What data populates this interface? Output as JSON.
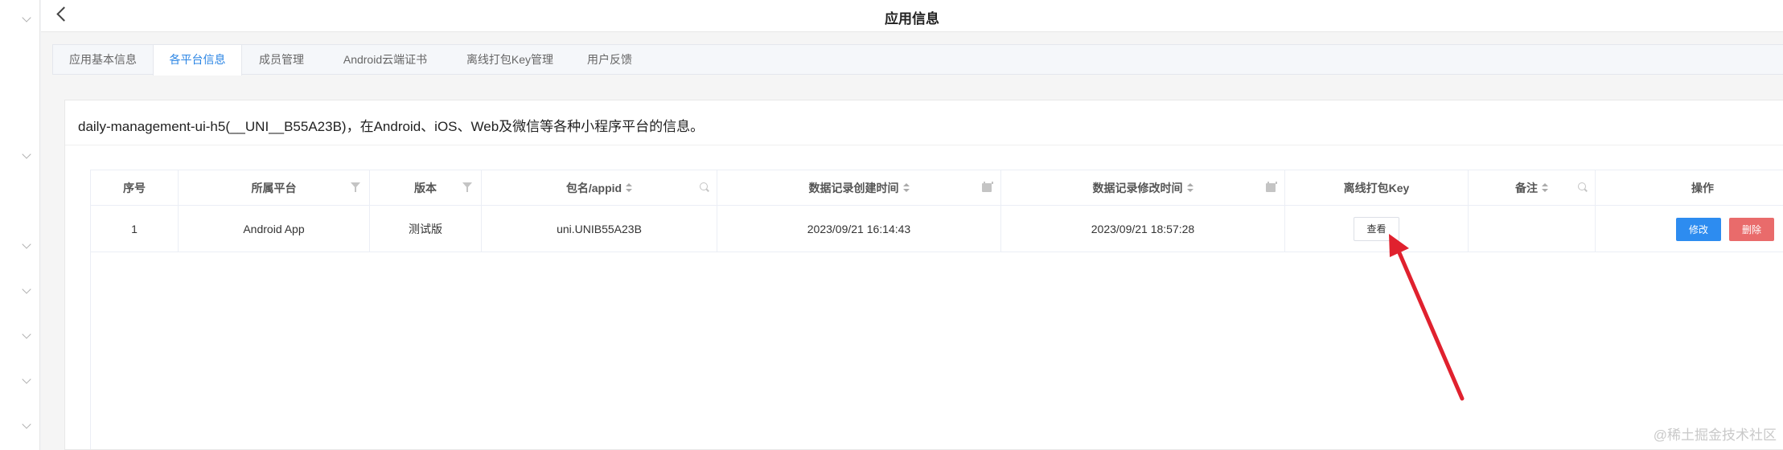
{
  "header": {
    "title": "应用信息"
  },
  "tabs": [
    {
      "label": "应用基本信息"
    },
    {
      "label": "各平台信息"
    },
    {
      "label": "成员管理"
    },
    {
      "label": "Android云端证书"
    },
    {
      "label": "离线打包Key管理"
    },
    {
      "label": "用户反馈"
    }
  ],
  "description": "daily-management-ui-h5(__UNI__B55A23B)，在Android、iOS、Web及微信等各种小程序平台的信息。",
  "table": {
    "headers": [
      "序号",
      "所属平台",
      "版本",
      "包名/appid",
      "数据记录创建时间",
      "数据记录修改时间",
      "离线打包Key",
      "备注",
      "操作"
    ],
    "rows": [
      {
        "index": "1",
        "platform": "Android App",
        "version": "测试版",
        "appid": "uni.UNIB55A23B",
        "created": "2023/09/21 16:14:43",
        "modified": "2023/09/21 18:57:28",
        "key_button": "查看",
        "note": "",
        "edit_button": "修改",
        "delete_button": "删除"
      }
    ]
  },
  "watermark": "@稀土掘金技术社区",
  "colors": {
    "primary": "#2d8cf0",
    "danger": "#e96b6b",
    "annotation": "#e0212e",
    "active_tab": "#2b85e4"
  }
}
